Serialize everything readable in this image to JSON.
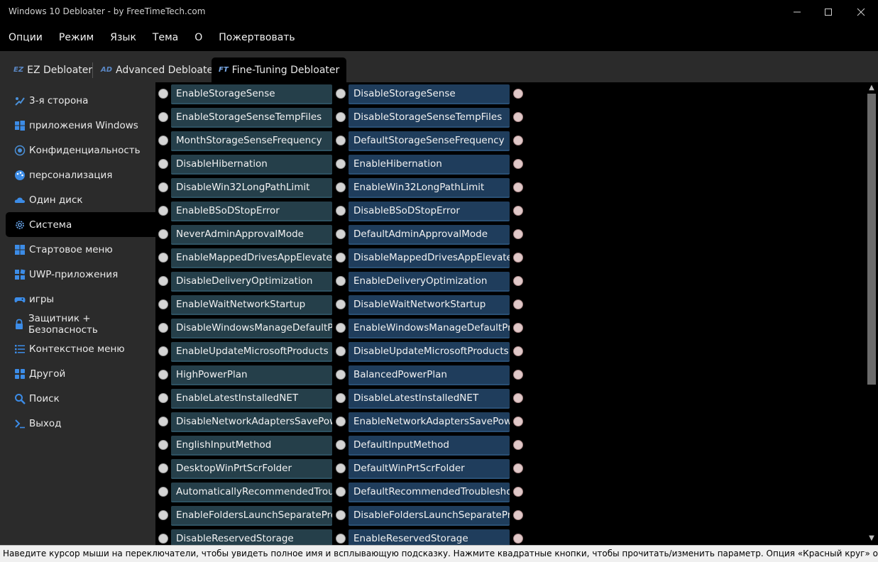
{
  "window": {
    "title": "Windows 10 Debloater - by FreeTimeTech.com"
  },
  "menu": [
    "Опции",
    "Режим",
    "Язык",
    "Тема",
    "О",
    "Пожертвовать"
  ],
  "tabs": [
    {
      "badge": "EZ",
      "label": "EZ Debloater"
    },
    {
      "badge": "AD",
      "label": "Advanced Debloater"
    },
    {
      "badge": "FT",
      "label": "Fine-Tuning Debloater"
    }
  ],
  "sidebar": [
    {
      "label": "3-я сторона",
      "icon": "third-party-icon"
    },
    {
      "label": "приложения Windows",
      "icon": "windows-icon"
    },
    {
      "label": "Конфиденциальность",
      "icon": "privacy-icon"
    },
    {
      "label": "персонализация",
      "icon": "personalization-icon"
    },
    {
      "label": "Один диск",
      "icon": "cloud-icon"
    },
    {
      "label": "Система",
      "icon": "gear-icon"
    },
    {
      "label": "Стартовое меню",
      "icon": "start-menu-icon"
    },
    {
      "label": "UWP-приложения",
      "icon": "apps-icon"
    },
    {
      "label": "игры",
      "icon": "gamepad-icon"
    },
    {
      "label": "Защитник + Безопасность",
      "icon": "lock-icon"
    },
    {
      "label": "Контекстное меню",
      "icon": "list-icon"
    },
    {
      "label": "Другой",
      "icon": "grid-icon"
    },
    {
      "label": "Поиск",
      "icon": "search-icon"
    },
    {
      "label": "Выход",
      "icon": "terminal-icon"
    }
  ],
  "options": [
    {
      "a": "EnableStorageSense",
      "b": "DisableStorageSense"
    },
    {
      "a": "EnableStorageSenseTempFiles",
      "b": "DisableStorageSenseTempFiles"
    },
    {
      "a": "MonthStorageSenseFrequency",
      "b": "DefaultStorageSenseFrequency"
    },
    {
      "a": "DisableHibernation",
      "b": "EnableHibernation"
    },
    {
      "a": "DisableWin32LongPathLimit",
      "b": "EnableWin32LongPathLimit"
    },
    {
      "a": "EnableBSoDStopError",
      "b": "DisableBSoDStopError"
    },
    {
      "a": "NeverAdminApprovalMode",
      "b": "DefaultAdminApprovalMode"
    },
    {
      "a": "EnableMappedDrivesAppElevatedAc",
      "b": "DisableMappedDrivesAppElevatedA"
    },
    {
      "a": "DisableDeliveryOptimization",
      "b": "EnableDeliveryOptimization"
    },
    {
      "a": "EnableWaitNetworkStartup",
      "b": "DisableWaitNetworkStartup"
    },
    {
      "a": "DisableWindowsManageDefaultPrin",
      "b": "EnableWindowsManageDefaultPrint"
    },
    {
      "a": "EnableUpdateMicrosoftProducts",
      "b": "DisableUpdateMicrosoftProducts"
    },
    {
      "a": "HighPowerPlan",
      "b": "BalancedPowerPlan"
    },
    {
      "a": "EnableLatestInstalledNET",
      "b": "DisableLatestInstalledNET"
    },
    {
      "a": "DisableNetworkAdaptersSavePower",
      "b": "EnableNetworkAdaptersSavePower"
    },
    {
      "a": "EnglishInputMethod",
      "b": "DefaultInputMethod"
    },
    {
      "a": "DesktopWinPrtScrFolder",
      "b": "DefaultWinPrtScrFolder"
    },
    {
      "a": "AutomaticallyRecommendedTrouble",
      "b": "DefaultRecommendedTroubleshooti"
    },
    {
      "a": "EnableFoldersLaunchSeparateProces",
      "b": "DisableFoldersLaunchSeparateProce"
    },
    {
      "a": "DisableReservedStorage",
      "b": "EnableReservedStorage"
    }
  ],
  "status": {
    "text": "Наведите курсор мыши на переключатели, чтобы увидеть полное имя и всплывающую подсказку. Нажмите квадратные кнопки, чтобы прочитать/изменить параметр. Опция «Красный круг» означает, что ничего не выбра"
  },
  "colors": {
    "accent": "#1f3d5c",
    "sidebar_bg": "#2b2b2b",
    "button_left": "#253f4a"
  }
}
